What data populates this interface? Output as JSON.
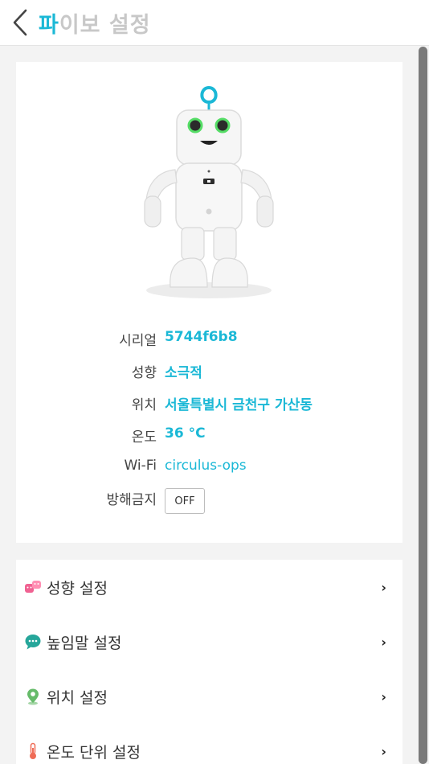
{
  "header": {
    "title_accent": "파",
    "title_rest": "이보 설정"
  },
  "info": {
    "rows": [
      {
        "label": "시리얼",
        "value": "5744f6b8"
      },
      {
        "label": "성향",
        "value": "소극적"
      },
      {
        "label": "위치",
        "value": "서울특별시 금천구 가산동"
      },
      {
        "label": "온도",
        "value": "36 °C"
      },
      {
        "label": "Wi-Fi",
        "value": "circulus-ops"
      },
      {
        "label": "방해금지",
        "value": "OFF"
      }
    ]
  },
  "menu": {
    "items": [
      {
        "label": "성향 설정",
        "icon": "masks-icon",
        "chevron": "›"
      },
      {
        "label": "높임말 설정",
        "icon": "speech-bubble-icon",
        "chevron": "›"
      },
      {
        "label": "위치 설정",
        "icon": "location-pin-icon",
        "chevron": "›"
      },
      {
        "label": "온도 단위 설정",
        "icon": "thermometer-icon",
        "chevron": "›"
      }
    ]
  },
  "colors": {
    "accent": "#1bb8d6",
    "title_gray": "#c8c8c8",
    "background": "#f3f3f3",
    "scrollbar": "#7a7a7a"
  }
}
